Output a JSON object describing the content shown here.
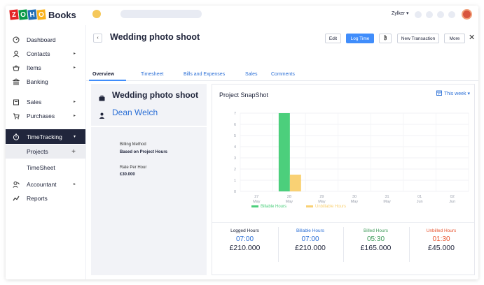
{
  "app": {
    "logo_letters": [
      "Z",
      "O",
      "H",
      "O"
    ],
    "logo_colors": [
      "#e42527",
      "#089949",
      "#226db4",
      "#f9b21d"
    ],
    "product": "Books",
    "organization": "Zylker"
  },
  "sidebar": {
    "items": [
      {
        "label": "Dashboard",
        "icon": "dashboard-icon",
        "arrow": ""
      },
      {
        "label": "Contacts",
        "icon": "contacts-icon",
        "arrow": "▸"
      },
      {
        "label": "Items",
        "icon": "items-icon",
        "arrow": "▸"
      },
      {
        "label": "Banking",
        "icon": "bank-icon",
        "arrow": ""
      },
      {
        "label": "Sales",
        "icon": "sales-icon",
        "arrow": "▸"
      },
      {
        "label": "Purchases",
        "icon": "purchases-icon",
        "arrow": "▸"
      },
      {
        "label": "TimeTracking",
        "icon": "stopwatch-icon",
        "arrow": "▾"
      },
      {
        "label": "Accountant",
        "icon": "accountant-icon",
        "arrow": "▸"
      },
      {
        "label": "Reports",
        "icon": "reports-icon",
        "arrow": ""
      }
    ],
    "sub_items": [
      {
        "label": "Projects",
        "action": "+"
      },
      {
        "label": "TimeSheet",
        "action": ""
      }
    ]
  },
  "header": {
    "back": "‹",
    "title": "Wedding photo shoot",
    "buttons": {
      "edit": "Edit",
      "log_time": "Log Time",
      "attach": "📎",
      "new_transaction": "New Transaction",
      "more": "More"
    },
    "close": "✕"
  },
  "tabs": [
    "Overview",
    "Timesheet",
    "Bills and Expenses",
    "Sales",
    "Comments"
  ],
  "project": {
    "name": "Wedding photo shoot",
    "customer": "Dean Welch",
    "billing_method_label": "Billing Method",
    "billing_method_value": "Based on Project Hours",
    "rate_label": "Rate Per Hour",
    "rate_value": "£30.000"
  },
  "snapshot": {
    "title": "Project SnapShot",
    "period": "This week",
    "period_arrow": "▾"
  },
  "chart_data": {
    "type": "bar",
    "categories": [
      "27 May",
      "28 May",
      "29 May",
      "30 May",
      "31 May",
      "01 Jun",
      "02 Jun"
    ],
    "x_top": [
      "27",
      "28",
      "29",
      "30",
      "31",
      "01",
      "02"
    ],
    "x_bottom": [
      "May",
      "May",
      "May",
      "May",
      "May",
      "Jun",
      "Jun"
    ],
    "yticks": [
      0,
      1,
      2,
      3,
      4,
      5,
      6,
      7
    ],
    "ylim": [
      0,
      7
    ],
    "grid": true,
    "series": [
      {
        "name": "Billable Hours",
        "color": "#4ccf7c",
        "values": [
          0,
          7,
          0,
          0,
          0,
          0,
          0
        ]
      },
      {
        "name": "Unbillable Hours",
        "color": "#f9d174",
        "values": [
          0,
          1.5,
          0,
          0,
          0,
          0,
          0
        ]
      }
    ],
    "legend": "bottom"
  },
  "summary": [
    {
      "label": "Logged Hours",
      "hours": "07:00",
      "amount": "£210.000",
      "color": "#21263c"
    },
    {
      "label": "Billable Hours",
      "hours": "07:00",
      "amount": "£210.000",
      "color": "#2b6fd6"
    },
    {
      "label": "Billed Hours",
      "hours": "05:30",
      "amount": "£165.000",
      "color": "#3e9b5a"
    },
    {
      "label": "Unbilled Hours",
      "hours": "01:30",
      "amount": "£45.000",
      "color": "#e8542f"
    }
  ]
}
